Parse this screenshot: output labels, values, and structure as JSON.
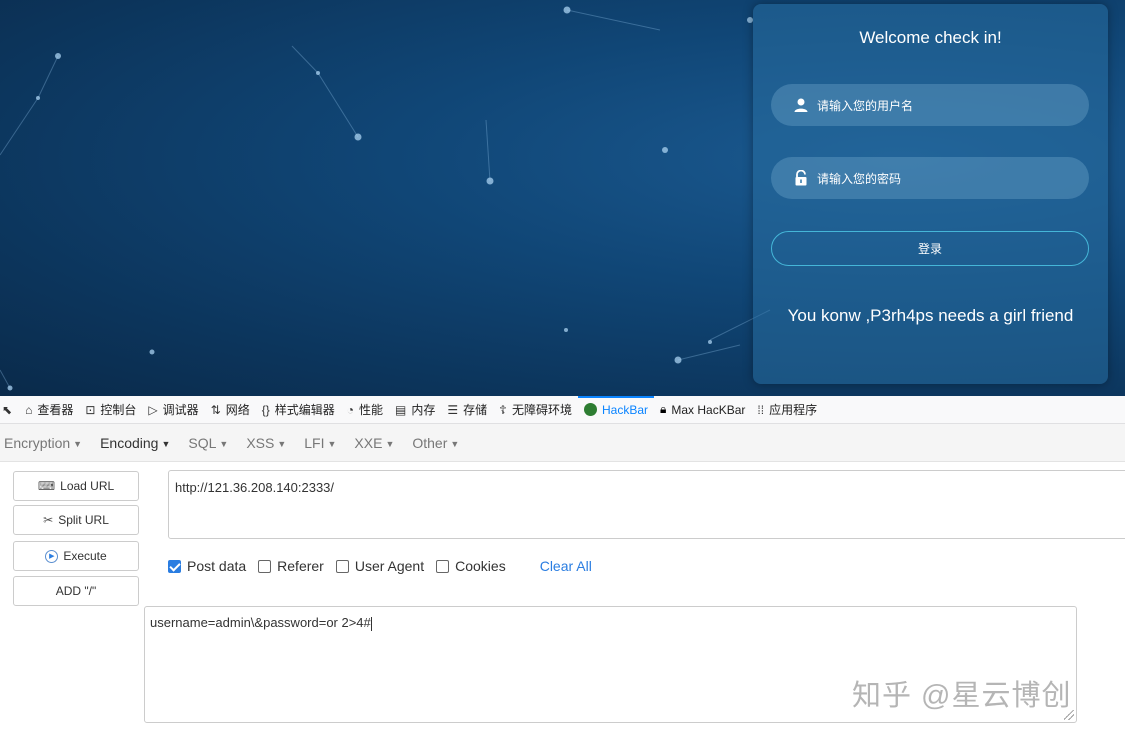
{
  "webpage": {
    "login_title": "Welcome check in!",
    "username_placeholder": "请输入您的用户名",
    "password_placeholder": "请输入您的密码",
    "login_button": "登录",
    "message": "You konw ,P3rh4ps needs a girl friend"
  },
  "devtools": {
    "tabs": [
      {
        "label": "查看器",
        "icon": "inspector-icon"
      },
      {
        "label": "控制台",
        "icon": "console-icon"
      },
      {
        "label": "调试器",
        "icon": "debugger-icon"
      },
      {
        "label": "网络",
        "icon": "network-icon"
      },
      {
        "label": "样式编辑器",
        "icon": "style-editor-icon"
      },
      {
        "label": "性能",
        "icon": "performance-icon"
      },
      {
        "label": "内存",
        "icon": "memory-icon"
      },
      {
        "label": "存储",
        "icon": "storage-icon"
      },
      {
        "label": "无障碍环境",
        "icon": "accessibility-icon"
      },
      {
        "label": "HackBar",
        "icon": "hackbar-icon",
        "active": true
      },
      {
        "label": "Max HacKBar",
        "icon": "max-hackbar-icon"
      },
      {
        "label": "应用程序",
        "icon": "applications-icon"
      }
    ],
    "active_color": "#0a84ff"
  },
  "hackbar": {
    "menu": [
      "Encryption",
      "Encoding",
      "SQL",
      "XSS",
      "LFI",
      "XXE",
      "Other"
    ],
    "buttons": {
      "load_url": "Load URL",
      "split_url": "Split URL",
      "execute": "Execute",
      "add_slash": "ADD \"/\""
    },
    "url": "http://121.36.208.140:2333/",
    "options": {
      "post_data": "Post data",
      "referer": "Referer",
      "user_agent": "User Agent",
      "cookies": "Cookies",
      "clear_all": "Clear All"
    },
    "post_data_checked": true,
    "post_body": "username=admin\\&password=or 2>4#"
  },
  "watermark": "知乎 @星云博创"
}
